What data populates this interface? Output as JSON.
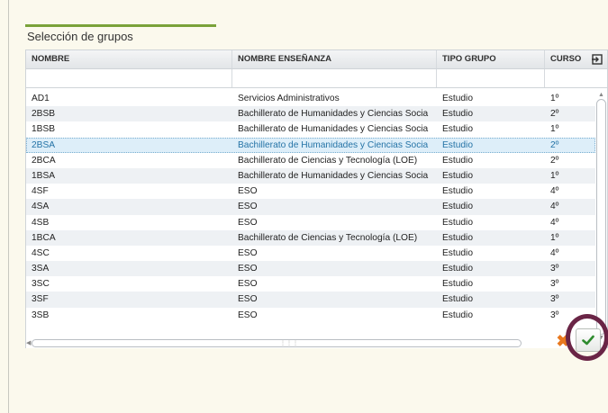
{
  "dialog": {
    "title": "Selección de grupos"
  },
  "grid": {
    "columns": [
      "NOMBRE",
      "NOMBRE ENSEÑANZA",
      "TIPO GRUPO",
      "CURSO"
    ],
    "filters": [
      "",
      "",
      "",
      ""
    ],
    "selected_row": 3,
    "rows": [
      [
        "AD1",
        "Servicios Administrativos",
        "Estudio",
        "1º"
      ],
      [
        "2BSB",
        "Bachillerato de Humanidades y Ciencias Socia",
        "Estudio",
        "2º"
      ],
      [
        "1BSB",
        "Bachillerato de Humanidades y Ciencias Socia",
        "Estudio",
        "1º"
      ],
      [
        "2BSA",
        "Bachillerato de Humanidades y Ciencias Socia",
        "Estudio",
        "2º"
      ],
      [
        "2BCA",
        "Bachillerato de Ciencias y Tecnología (LOE)",
        "Estudio",
        "2º"
      ],
      [
        "1BSA",
        "Bachillerato de Humanidades y Ciencias Socia",
        "Estudio",
        "1º"
      ],
      [
        "4SF",
        "ESO",
        "Estudio",
        "4º"
      ],
      [
        "4SA",
        "ESO",
        "Estudio",
        "4º"
      ],
      [
        "4SB",
        "ESO",
        "Estudio",
        "4º"
      ],
      [
        "1BCA",
        "Bachillerato de Ciencias y Tecnología (LOE)",
        "Estudio",
        "1º"
      ],
      [
        "4SC",
        "ESO",
        "Estudio",
        "4º"
      ],
      [
        "3SA",
        "ESO",
        "Estudio",
        "3º"
      ],
      [
        "3SC",
        "ESO",
        "Estudio",
        "3º"
      ],
      [
        "3SF",
        "ESO",
        "Estudio",
        "3º"
      ],
      [
        "3SB",
        "ESO",
        "Estudio",
        "3º"
      ]
    ]
  },
  "icons": {
    "export": "export-icon",
    "cancel": "close-icon",
    "accept": "check-icon"
  },
  "colors": {
    "accent": "#7aa23a",
    "selected_row_bg": "#ddeef9",
    "selected_row_text": "#2473a6",
    "cancel": "#e8781e",
    "accept": "#2e8b2e",
    "highlight": "#6a2546"
  }
}
